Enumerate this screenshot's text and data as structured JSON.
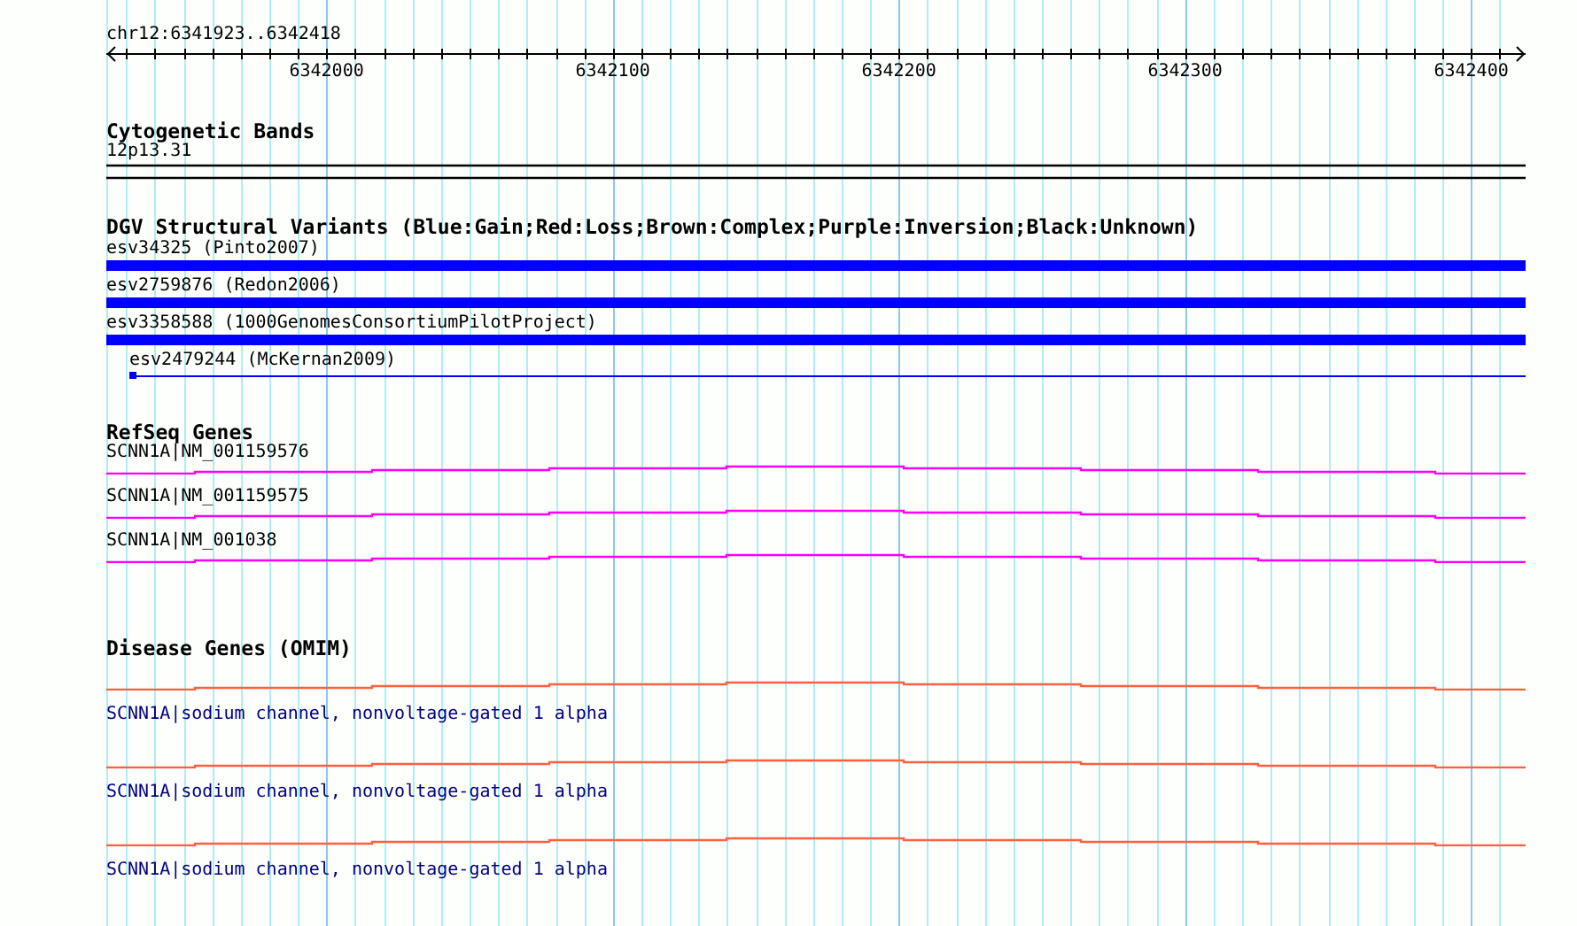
{
  "ruler": {
    "location": "chr12:6341923..6342418",
    "ticks": [
      "6342000",
      "6342100",
      "6342200",
      "6342300",
      "6342400"
    ]
  },
  "cytogenetic_bands": {
    "title": "Cytogenetic Bands",
    "items": [
      {
        "label": "12p13.31"
      }
    ]
  },
  "dgv": {
    "title": "DGV Structural Variants (Blue:Gain;Red:Loss;Brown:Complex;Purple:Inversion;Black:Unknown)",
    "items": [
      {
        "label": "esv34325 (Pinto2007)",
        "kind": "block",
        "color": "#0000ff"
      },
      {
        "label": "esv2759876 (Redon2006)",
        "kind": "block",
        "color": "#0000ff"
      },
      {
        "label": "esv3358588 (1000GenomesConsortiumPilotProject)",
        "kind": "block",
        "color": "#0000ff"
      },
      {
        "label": "esv2479244 (McKernan2009)",
        "kind": "thin",
        "color": "#0000ff"
      }
    ]
  },
  "refseq": {
    "title": "RefSeq Genes",
    "items": [
      {
        "label": "SCNN1A|NM_001159576"
      },
      {
        "label": "SCNN1A|NM_001159575"
      },
      {
        "label": "SCNN1A|NM_001038"
      }
    ]
  },
  "omim": {
    "title": "Disease Genes (OMIM)",
    "items": [
      {
        "label": "SCNN1A|sodium channel, nonvoltage-gated 1 alpha"
      },
      {
        "label": "SCNN1A|sodium channel, nonvoltage-gated 1 alpha"
      },
      {
        "label": "SCNN1A|sodium channel, nonvoltage-gated 1 alpha"
      }
    ]
  }
}
